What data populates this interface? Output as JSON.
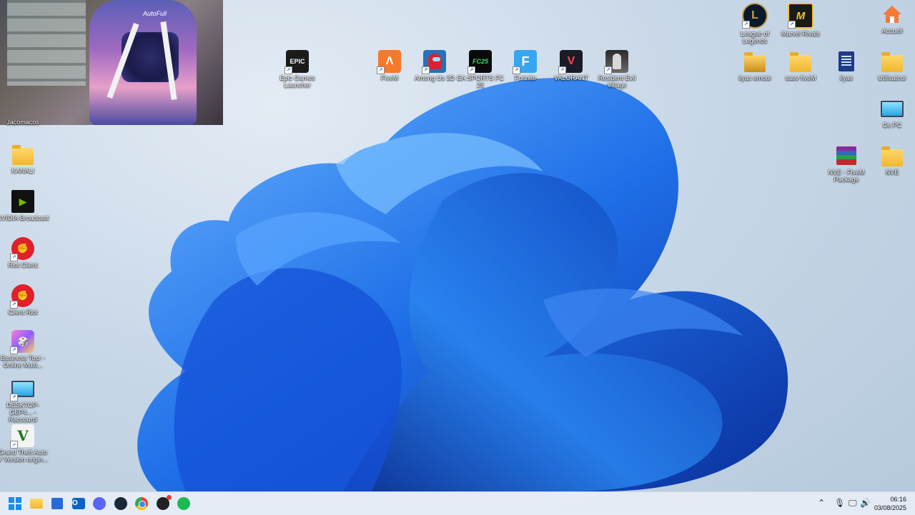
{
  "webcam": {
    "chair_brand": "AutoFull"
  },
  "desktop_icons": {
    "partial_top": "Jacomacos",
    "kanali": "KANALI",
    "nvidia": "NVIDIA Broadcast",
    "riot_client": "Riot Client",
    "client_riot": "Client Riot",
    "business_tour": "Business Tour - Online Multi...",
    "desktop_shortcut": "DESKTOP-GEP4... - Raccourci",
    "gta": "Grand Theft Auto V Version origin...",
    "epic": "Epic Games Launcher",
    "fivem": "FiveM",
    "among_us": "Among Us 3D",
    "fc25": "EA SPORTS FC 25",
    "fortnite": "Fortnite",
    "valorant": "VALORANT",
    "resident_evil": "Resident Evil Village",
    "lol": "League of Legends",
    "marvel": "Marvel Rivals",
    "accueil": "Accueil",
    "ilyas_emote": "ilyas emote",
    "sauv_fivem": "sauv fiveM",
    "ilyas": "ilyas",
    "utilisateur": "Utilisateur",
    "ce_pc": "Ce PC",
    "nve_package": "NVE - FiveM Package",
    "nve": "NVE"
  },
  "icon_glyphs": {
    "epic": "EPIC",
    "fivem": "Λ",
    "fc25": "FC25",
    "fortnite": "F",
    "valorant": "V",
    "lol": "L",
    "marvel": "M",
    "gta": "V",
    "nvidia": "▶"
  },
  "taskbar": {
    "time": "06:16",
    "date": "03/08/2025",
    "apps": [
      "start-icon",
      "file-explorer-icon",
      "microsoft-store-icon",
      "outlook-icon",
      "discord-icon",
      "steam-icon",
      "chrome-icon",
      "obs-icon",
      "spotify-icon"
    ]
  },
  "colors": {
    "wallpaper_blue": "#1a5fd0",
    "folder": "#f7c948",
    "taskbar": "#e8eef6"
  }
}
